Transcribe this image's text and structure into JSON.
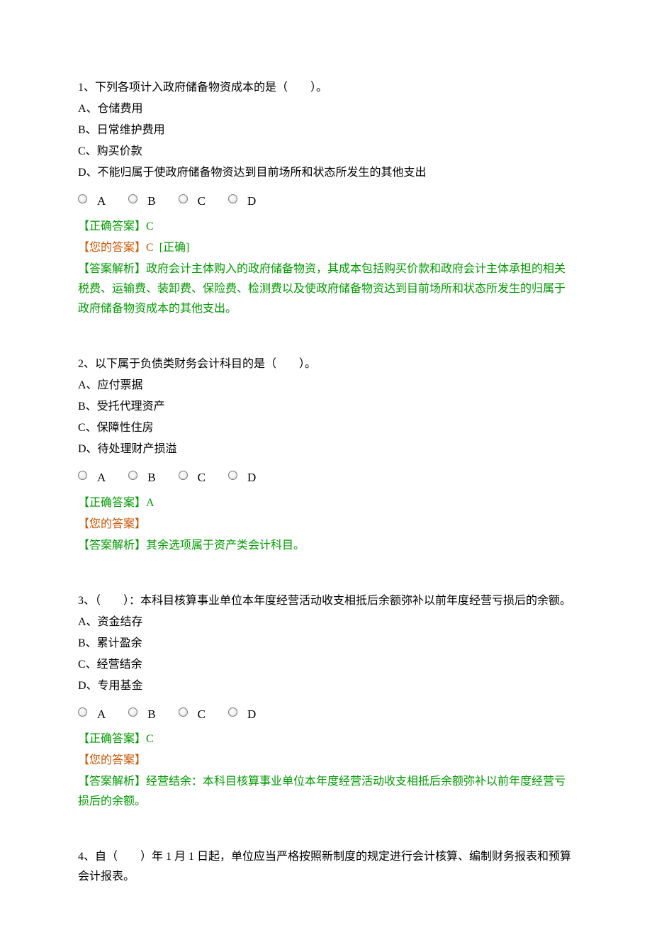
{
  "questions": [
    {
      "stem": "1、下列各项计入政府储备物资成本的是（　　）。",
      "options": [
        "A、仓储费用",
        "B、日常维护费用",
        "C、购买价款",
        "D、不能归属于使政府储备物资达到目前场所和状态所发生的其他支出"
      ],
      "radios": [
        "A",
        "B",
        "C",
        "D"
      ],
      "correct_label": "【正确答案】",
      "correct_value": "C",
      "your_label": "【您的答案】",
      "your_value": "C",
      "status_text": "[正确]",
      "explain": "【答案解析】政府会计主体购入的政府储备物资，其成本包括购买价款和政府会计主体承担的相关税费、运输费、装卸费、保险费、检测费以及使政府储备物资达到目前场所和状态所发生的归属于政府储备物资成本的其他支出。"
    },
    {
      "stem": "2、以下属于负债类财务会计科目的是（　　）。",
      "options": [
        "A、应付票据",
        "B、受托代理资产",
        "C、保障性住房",
        "D、待处理财产损溢"
      ],
      "radios": [
        "A",
        "B",
        "C",
        "D"
      ],
      "correct_label": "【正确答案】",
      "correct_value": "A",
      "your_label": "【您的答案】",
      "your_value": "",
      "status_text": "",
      "explain": "【答案解析】其余选项属于资产类会计科目。"
    },
    {
      "stem": "3、（　　）：本科目核算事业单位本年度经营活动收支相抵后余额弥补以前年度经营亏损后的余额。",
      "options": [
        "A、资金结存",
        "B、累计盈余",
        "C、经营结余",
        "D、专用基金"
      ],
      "radios": [
        "A",
        "B",
        "C",
        "D"
      ],
      "correct_label": "【正确答案】",
      "correct_value": "C",
      "your_label": "【您的答案】",
      "your_value": "",
      "status_text": "",
      "explain": "【答案解析】经营结余：本科目核算事业单位本年度经营活动收支相抵后余额弥补以前年度经营亏损后的余额。"
    },
    {
      "stem": "4、自（　　）年 1 月 1 日起，单位应当严格按照新制度的规定进行会计核算、编制财务报表和预算会计报表。",
      "options": [],
      "radios": [],
      "correct_label": "",
      "correct_value": "",
      "your_label": "",
      "your_value": "",
      "status_text": "",
      "explain": ""
    }
  ]
}
